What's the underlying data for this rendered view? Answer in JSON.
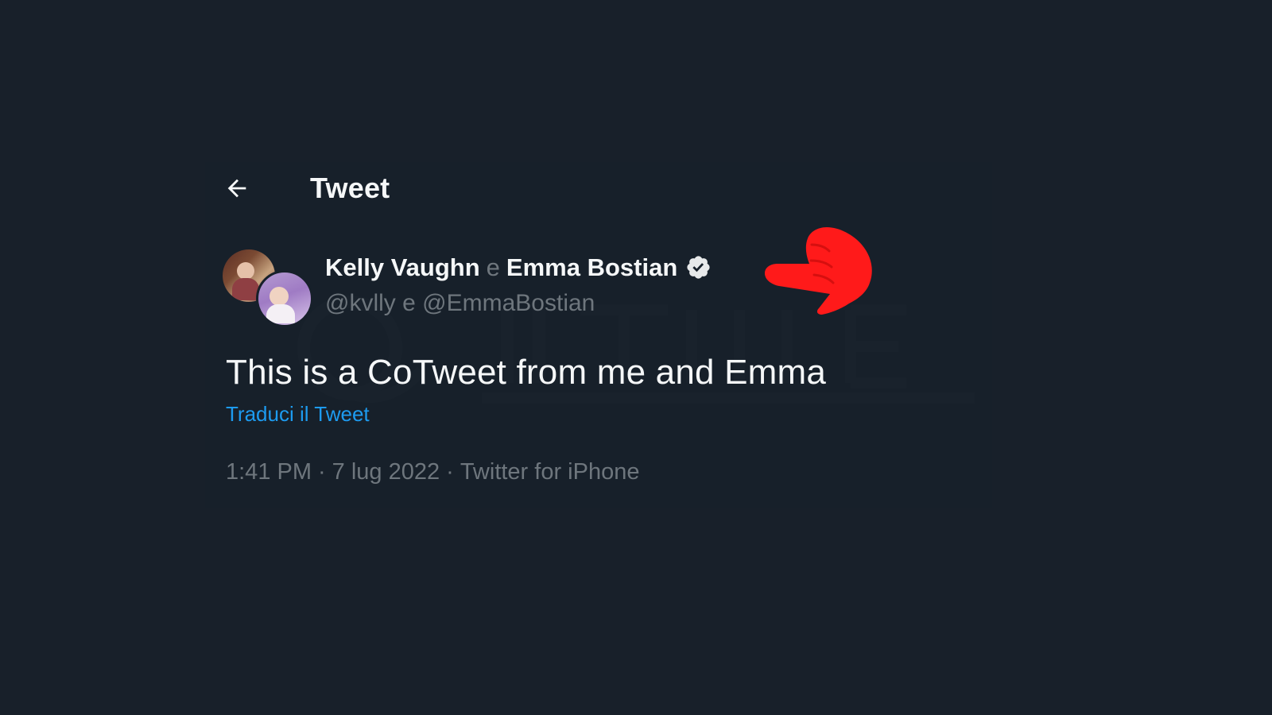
{
  "header": {
    "title": "Tweet"
  },
  "tweet": {
    "author_1": "Kelly Vaughn",
    "connector": "e",
    "author_2": "Emma Bostian",
    "handle_1": "@kvlly",
    "handle_connector": "e",
    "handle_2": "@EmmaBostian",
    "text": "This is a CoTweet from me and Emma",
    "translate_label": "Traduci il Tweet",
    "time": "1:41 PM",
    "date": "7 lug 2022",
    "source": "Twitter for iPhone"
  },
  "colors": {
    "background": "#18202a",
    "text_primary": "#f5f7f8",
    "text_secondary": "#6e767d",
    "link": "#1d9bf0",
    "annotation_arrow": "#ff1a1a"
  },
  "icons": {
    "back": "back-arrow-icon",
    "verified": "verified-badge-icon",
    "annotation": "pointing-hand-icon"
  }
}
